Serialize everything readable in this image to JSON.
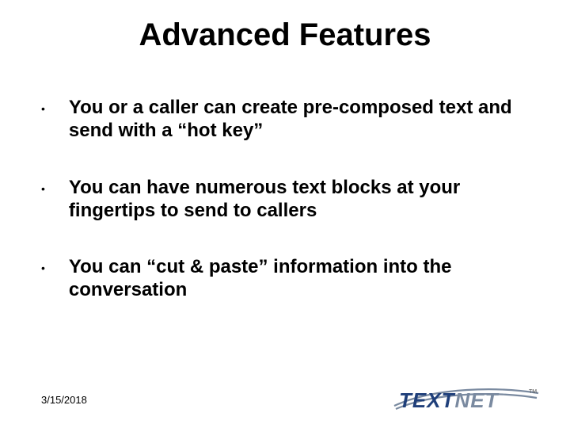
{
  "title": "Advanced Features",
  "bullets": [
    "You or a caller can create pre-composed text and send with a “hot key”",
    "You can have numerous text blocks at your fingertips to send to callers",
    "You can “cut & paste” information into the conversation"
  ],
  "footer": {
    "date": "3/15/2018"
  },
  "logo": {
    "part1": "TEXT",
    "part2": "NET",
    "tm": "TM"
  }
}
